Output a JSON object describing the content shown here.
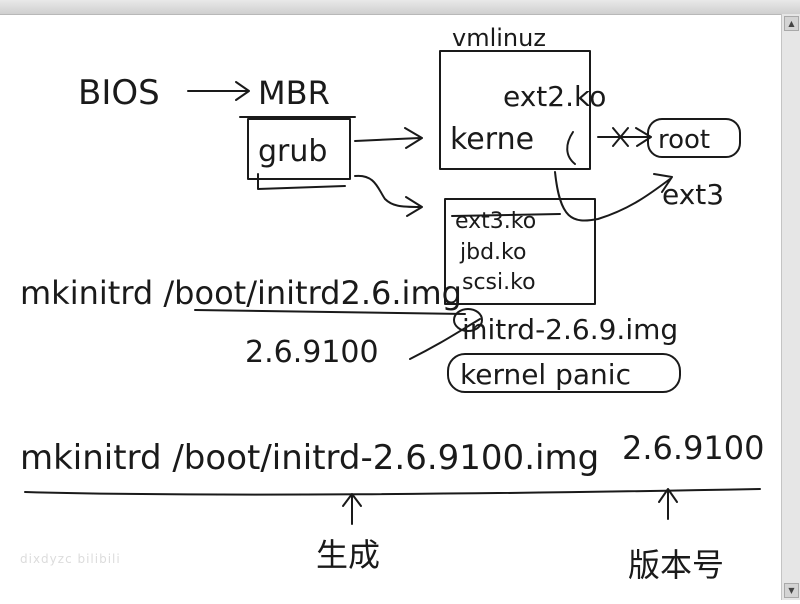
{
  "labels": {
    "bios": "BIOS",
    "mbr": "MBR",
    "grub": "grub",
    "vmlinuz": "vmlinuz",
    "ext2_ko": "ext2.ko",
    "kernel": "kerne",
    "root": "root",
    "ext3": "ext3",
    "initrd_ext3": "ext3.ko",
    "initrd_jbd": "jbd.ko",
    "initrd_scsi": "scsi.ko",
    "cmd1": "mkinitrd /boot/initrd2.6.img",
    "ver1": "2.6.9100",
    "initrd_img": "initrd-2.6.9.img",
    "kernel_panic": "kernel panic",
    "cmd2": "mkinitrd /boot/initrd-2.6.9100.img",
    "ver2": "2.6.9100",
    "generate": "生成",
    "version": "版本号"
  },
  "watermark": "dixdyzc bilibili"
}
